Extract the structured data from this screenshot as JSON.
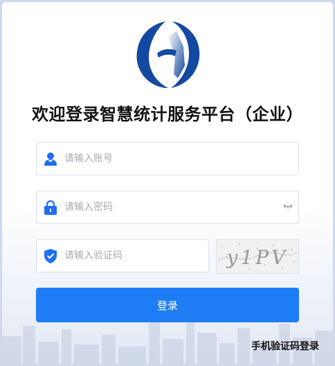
{
  "title": "欢迎登录智慧统计服务平台（企业）",
  "account": {
    "placeholder": "请输入账号",
    "value": ""
  },
  "password": {
    "placeholder": "请输入密码",
    "value": ""
  },
  "captcha": {
    "placeholder": "请输入验证码",
    "value": "",
    "image_text": "y1PV"
  },
  "login_button": "登录",
  "sms_login_link": "手机验证码登录",
  "icons": {
    "account": "user-icon",
    "password": "lock-icon",
    "captcha": "shield-check-icon",
    "toggle": "eye-closed-icon"
  },
  "colors": {
    "primary": "#1e7df5",
    "logo_blue": "#1349a0",
    "icon_blue": "#1e6ff2"
  }
}
